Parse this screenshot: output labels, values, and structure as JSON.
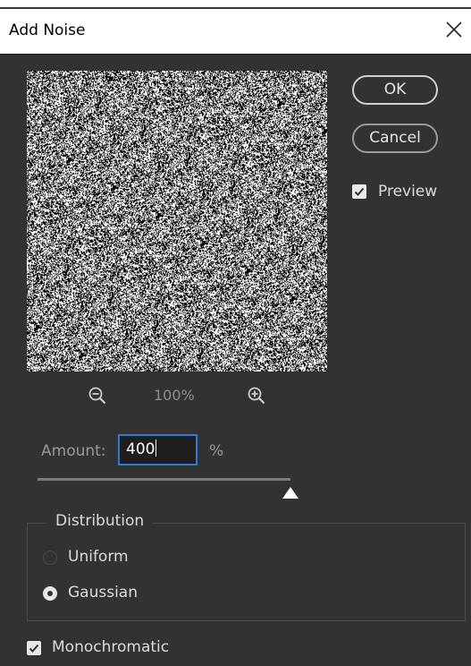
{
  "dialog": {
    "title": "Add Noise"
  },
  "buttons": {
    "ok": "OK",
    "cancel": "Cancel"
  },
  "preview": {
    "label": "Preview",
    "checked": true,
    "zoom": "100%"
  },
  "amount": {
    "label": "Amount:",
    "value": "400",
    "unit": "%",
    "slider_fraction": 1.0
  },
  "distribution": {
    "legend": "Distribution",
    "options": [
      {
        "label": "Uniform",
        "selected": false
      },
      {
        "label": "Gaussian",
        "selected": true
      }
    ]
  },
  "monochromatic": {
    "label": "Monochromatic",
    "checked": true
  },
  "icons": {
    "close": "close-icon",
    "zoom_out": "zoom-out-icon",
    "zoom_in": "zoom-in-icon",
    "check": "checkmark-icon"
  },
  "colors": {
    "focus_border": "#2f7ad4",
    "background": "#323232"
  }
}
